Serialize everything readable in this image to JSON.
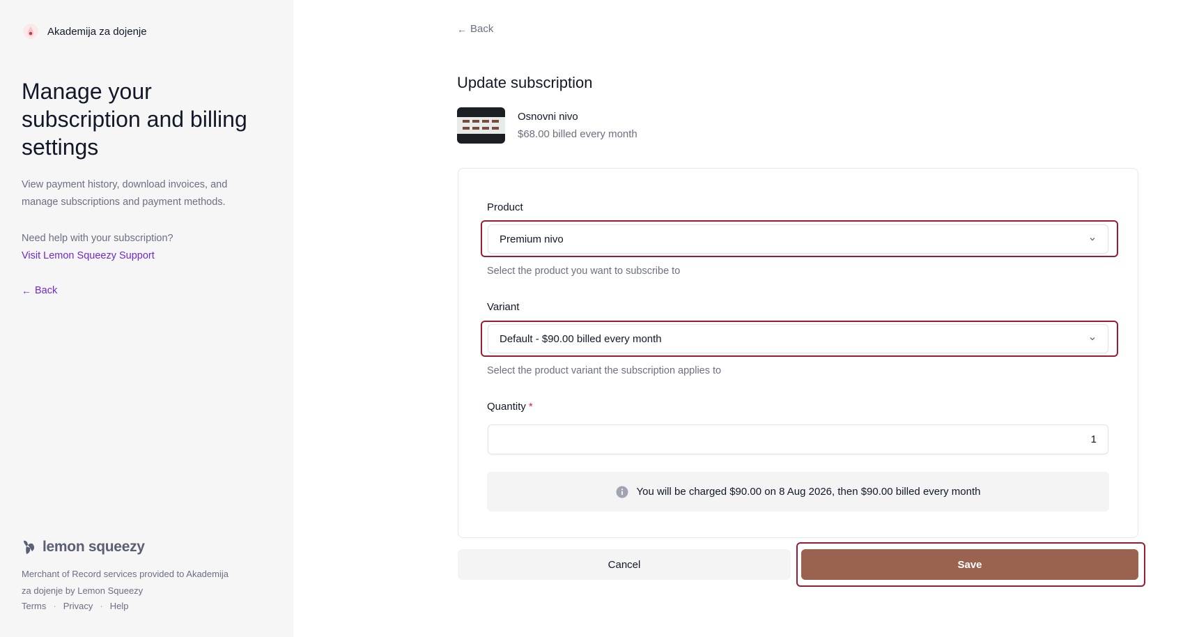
{
  "sidebar": {
    "brand_name": "Akademija za dojenje",
    "title": "Manage your subscription and billing settings",
    "description": "View payment history, download invoices, and manage subscriptions and payment methods.",
    "help_text": "Need help with your subscription?",
    "support_link": "Visit Lemon Squeezy Support",
    "back_label": "Back",
    "footer": {
      "logo_text": "lemon squeezy",
      "merchant_text": "Merchant of Record services provided to Akademija za dojenje by Lemon Squeezy",
      "links": [
        "Terms",
        "Privacy",
        "Help"
      ],
      "separator": "·"
    }
  },
  "main": {
    "back_label": "Back",
    "page_title": "Update subscription",
    "current_plan": {
      "name": "Osnovni nivo",
      "price": "$68.00 billed every month"
    },
    "form": {
      "product": {
        "label": "Product",
        "value": "Premium nivo",
        "hint": "Select the product you want to subscribe to"
      },
      "variant": {
        "label": "Variant",
        "value": "Default - $90.00 billed every month",
        "hint": "Select the product variant the subscription applies to"
      },
      "quantity": {
        "label": "Quantity",
        "required_mark": "*",
        "value": "1"
      },
      "notice": "You will be charged $90.00 on 8 Aug 2026, then $90.00 billed every month"
    },
    "actions": {
      "cancel_label": "Cancel",
      "save_label": "Save"
    }
  },
  "icons": {
    "back": "arrow-left-icon",
    "select": "chevron-down-icon",
    "info": "info-icon"
  },
  "colors": {
    "accent_link": "#6d28d9",
    "save_button": "#9a6350",
    "highlight_border": "#9b1b30",
    "sidebar_bg": "#f6f6f7"
  }
}
